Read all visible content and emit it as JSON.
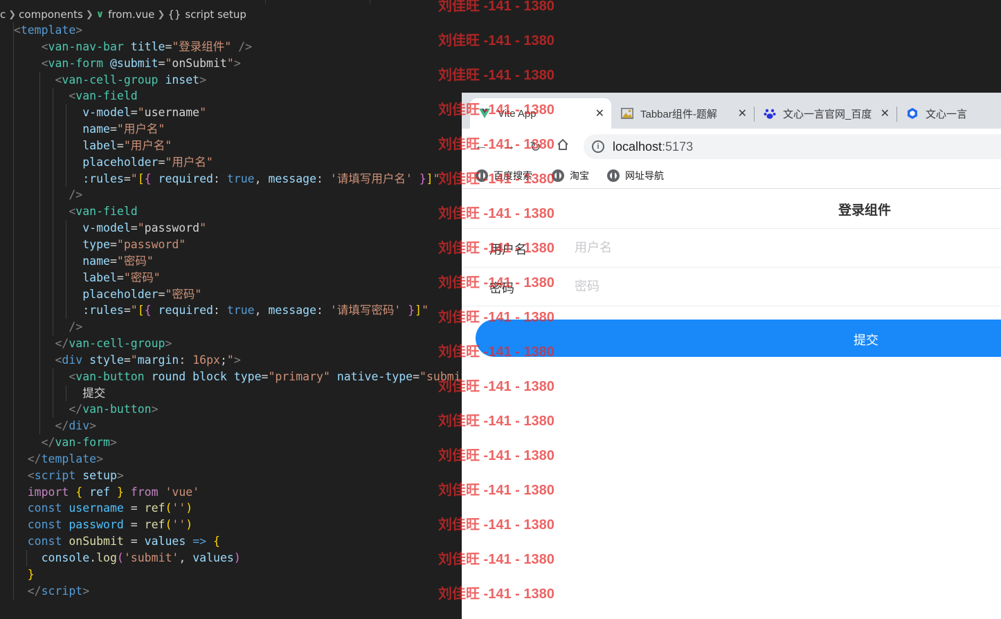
{
  "editor": {
    "breadcrumb": {
      "p0": "c",
      "p1": "components",
      "p2": "from.vue",
      "p3": "script setup"
    }
  },
  "browser": {
    "tabs": [
      {
        "label": "Vite App",
        "icon": "vite-icon"
      },
      {
        "label": "Tabbar组件-题解",
        "icon": "image-icon"
      },
      {
        "label": "文心一言官网_百度",
        "icon": "baidu-paw-icon"
      },
      {
        "label": "文心一言",
        "icon": "ernie-icon"
      }
    ],
    "url": {
      "host": "localhost",
      "port": ":5173"
    },
    "bookmarks": [
      {
        "label": "百度搜索",
        "icon": "globe-icon"
      },
      {
        "label": "淘宝",
        "icon": "globe-icon"
      },
      {
        "label": "网址导航",
        "icon": "globe-icon"
      }
    ]
  },
  "app": {
    "nav_title": "登录组件",
    "username": {
      "label": "用户名",
      "placeholder": "用户名",
      "value": ""
    },
    "password": {
      "label": "密码",
      "placeholder": "密码",
      "value": ""
    },
    "submit_label": "提交"
  },
  "watermark": {
    "text": "刘佳旺 -141 - 1380"
  },
  "colors": {
    "accent": "#1989fa",
    "editor_bg": "#1f1f1f",
    "watermark": "#e62828"
  }
}
